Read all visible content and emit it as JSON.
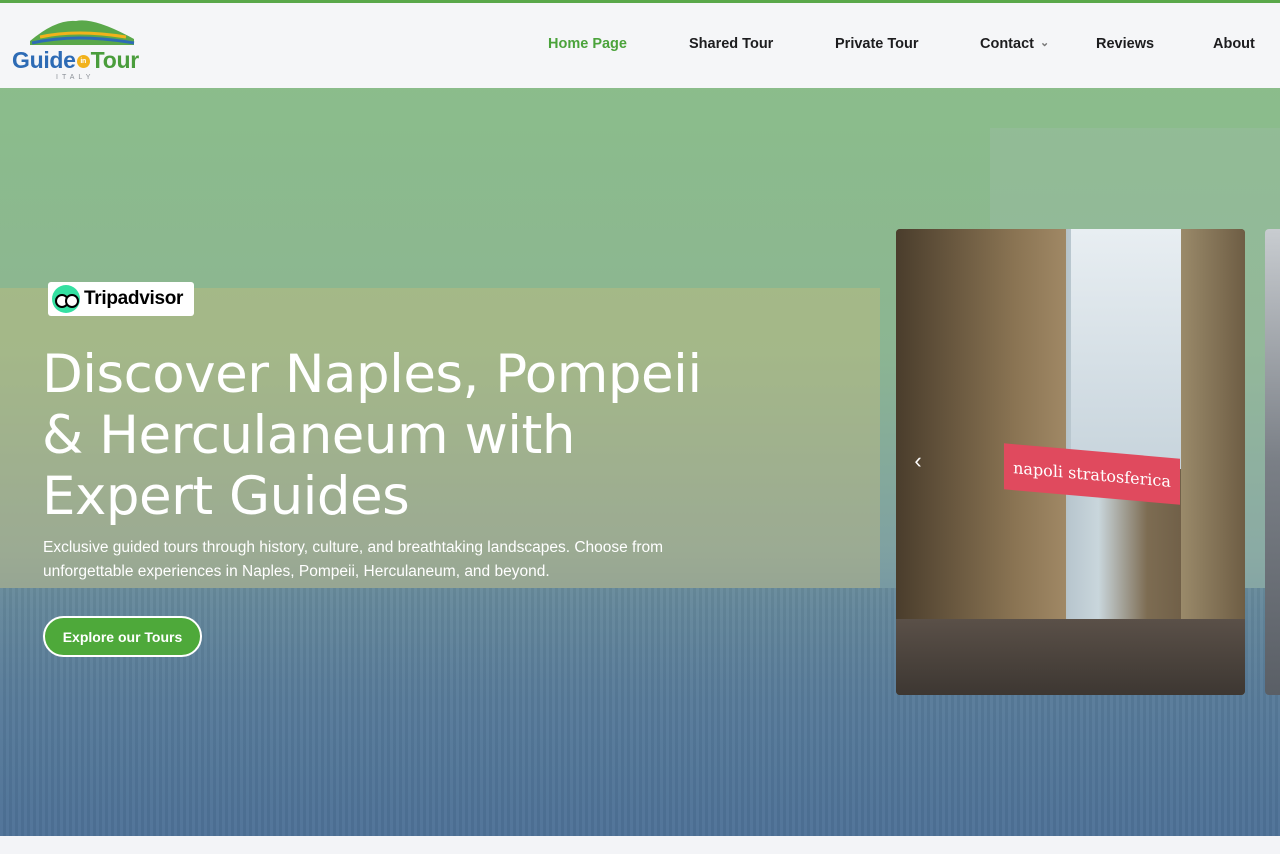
{
  "brand": {
    "name_part1": "Guide",
    "name_in": "in",
    "name_part2": "Tour",
    "country": "ITALY"
  },
  "nav": {
    "items": [
      {
        "label": "Home Page",
        "active": true
      },
      {
        "label": "Shared Tour"
      },
      {
        "label": "Private Tour"
      },
      {
        "label": "Contact",
        "has_dropdown": true
      },
      {
        "label": "Reviews"
      },
      {
        "label": "About"
      }
    ]
  },
  "hero": {
    "badge": "Tripadvisor",
    "title_line1": "Discover Naples, Pompeii",
    "title_line2": "& Herculaneum with",
    "title_line3": "Expert Guides",
    "subtitle_line1": "Exclusive guided tours through history, culture, and breathtaking landscapes. Choose from",
    "subtitle_line2": "unforgettable experiences in Naples, Pompeii, Herculaneum, and beyond.",
    "cta_label": "Explore our Tours"
  },
  "carousel": {
    "banner_text": "napoli stratosferica",
    "prev_icon": "chevron-left-icon"
  },
  "colors": {
    "accent": "#4ea93a",
    "brand_blue": "#2d6bb5",
    "active_nav": "#4ba33b"
  }
}
